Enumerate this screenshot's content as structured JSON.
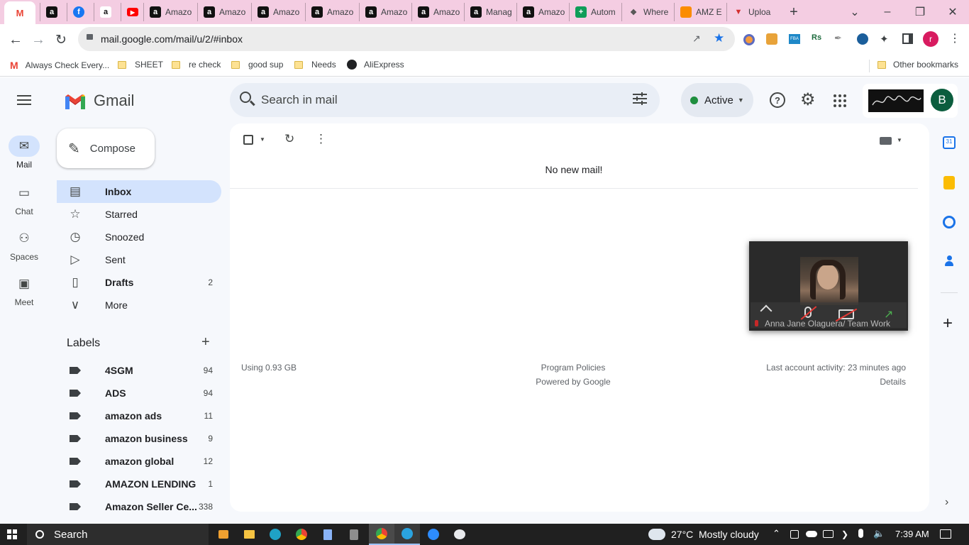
{
  "browser": {
    "tabs": [
      {
        "label": "",
        "favicon": "gmail-icon",
        "active": true
      },
      {
        "label": "",
        "favicon": "amazon-icon"
      },
      {
        "label": "",
        "favicon": "facebook-icon"
      },
      {
        "label": "",
        "favicon": "amazon-smile-icon"
      },
      {
        "label": "",
        "favicon": "youtube-icon"
      },
      {
        "label": "Amazo",
        "favicon": "amazon-icon"
      },
      {
        "label": "Amazo",
        "favicon": "amazon-icon"
      },
      {
        "label": "Amazo",
        "favicon": "amazon-icon"
      },
      {
        "label": "Amazo",
        "favicon": "amazon-icon"
      },
      {
        "label": "Amazo",
        "favicon": "amazon-icon"
      },
      {
        "label": "Amazo",
        "favicon": "amazon-icon"
      },
      {
        "label": "Manag",
        "favicon": "amazon-icon"
      },
      {
        "label": "Amazo",
        "favicon": "amazon-icon"
      },
      {
        "label": "Autom",
        "favicon": "sheets-plus-icon"
      },
      {
        "label": "Where",
        "favicon": "paw-icon"
      },
      {
        "label": "AMZ E",
        "favicon": "amz-icon"
      },
      {
        "label": "Uploa",
        "favicon": "upload-icon"
      }
    ],
    "new_tab": "+",
    "url": "mail.google.com/mail/u/2/#inbox",
    "bookmarks": [
      {
        "label": "Always Check Every...",
        "icon": "gmail-icon"
      },
      {
        "label": "SHEET",
        "icon": "folder-icon"
      },
      {
        "label": "re check",
        "icon": "folder-icon"
      },
      {
        "label": "good sup",
        "icon": "folder-icon"
      },
      {
        "label": "Needs",
        "icon": "folder-icon"
      },
      {
        "label": "AliExpress",
        "icon": "globe-icon"
      }
    ],
    "other_bookmarks": "Other bookmarks",
    "profile_initial": "r"
  },
  "gmail": {
    "logo_text": "Gmail",
    "search_placeholder": "Search in mail",
    "status": "Active",
    "account_initial": "B",
    "rail": [
      {
        "label": "Mail",
        "icon": "mail-icon"
      },
      {
        "label": "Chat",
        "icon": "chat-icon"
      },
      {
        "label": "Spaces",
        "icon": "spaces-icon"
      },
      {
        "label": "Meet",
        "icon": "meet-icon"
      }
    ],
    "compose": "Compose",
    "nav": [
      {
        "label": "Inbox",
        "count": "",
        "icon": "inbox-icon",
        "bold": true
      },
      {
        "label": "Starred",
        "count": "",
        "icon": "star-icon"
      },
      {
        "label": "Snoozed",
        "count": "",
        "icon": "clock-icon"
      },
      {
        "label": "Sent",
        "count": "",
        "icon": "send-icon"
      },
      {
        "label": "Drafts",
        "count": "2",
        "icon": "draft-icon",
        "bold": true
      },
      {
        "label": "More",
        "count": "",
        "icon": "chevron-down-icon"
      }
    ],
    "labels_title": "Labels",
    "labels": [
      {
        "label": "4SGM",
        "count": "94"
      },
      {
        "label": "ADS",
        "count": "94"
      },
      {
        "label": "amazon ads",
        "count": "11"
      },
      {
        "label": "amazon business",
        "count": "9"
      },
      {
        "label": "amazon global",
        "count": "12"
      },
      {
        "label": "AMAZON LENDING",
        "count": "1"
      },
      {
        "label": "Amazon Seller Ce...",
        "count": "338"
      }
    ],
    "empty_message": "No new mail!",
    "footer": {
      "storage": "Using 0.93 GB",
      "policies": "Program Policies",
      "powered": "Powered by Google",
      "activity": "Last account activity: 23 minutes ago",
      "details": "Details"
    },
    "video_overlay": {
      "caption": "Anna Jane Olaguera/ Team Work"
    }
  },
  "taskbar": {
    "search": "Search",
    "weather_temp": "27°C",
    "weather_text": "Mostly cloudy",
    "time": "7:39 AM"
  }
}
